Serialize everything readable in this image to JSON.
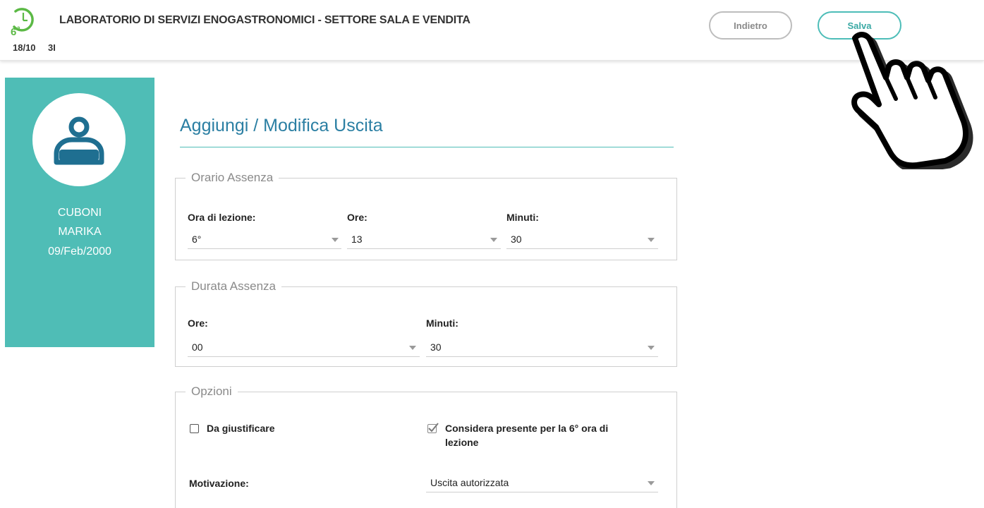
{
  "header": {
    "title": "LABORATORIO DI SERVIZI ENOGASTRONOMICI - SETTORE SALA E VENDITA",
    "date": "18/10",
    "class": "3I",
    "logo_hour": "6",
    "logo_sup": "a",
    "back_label": "Indietro",
    "save_label": "Salva",
    "accent_color": "#4fbdb6"
  },
  "student": {
    "surname": "CUBONI",
    "name": "MARIKA",
    "birth_date": "09/Feb/2000"
  },
  "page": {
    "title": "Aggiungi / Modifica Uscita"
  },
  "orario_assenza": {
    "legend": "Orario Assenza",
    "ora_lezione_label": "Ora di lezione:",
    "ora_lezione_value": "6°",
    "ore_label": "Ore:",
    "ore_value": "13",
    "minuti_label": "Minuti:",
    "minuti_value": "30"
  },
  "durata_assenza": {
    "legend": "Durata Assenza",
    "ore_label": "Ore:",
    "ore_value": "00",
    "minuti_label": "Minuti:",
    "minuti_value": "30"
  },
  "opzioni": {
    "legend": "Opzioni",
    "da_giustificare_label": "Da giustificare",
    "da_giustificare_checked": false,
    "considera_presente_line1": "Considera presente per la 6° ora di",
    "considera_presente_line2": "lezione",
    "considera_presente_checked": true,
    "motivazione_label": "Motivazione:",
    "motivazione_value": "Uscita autorizzata"
  }
}
